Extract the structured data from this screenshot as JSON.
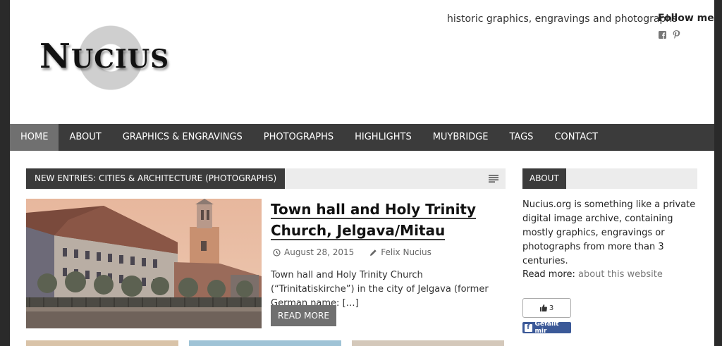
{
  "header": {
    "logo": "Nucius",
    "tagline": "historic graphics, engravings and photographs",
    "follow_label": "Follow me",
    "social_icons": [
      "facebook-icon",
      "pinterest-icon"
    ]
  },
  "nav": {
    "items": [
      {
        "label": "HOME",
        "active": true
      },
      {
        "label": "ABOUT"
      },
      {
        "label": "GRAPHICS & ENGRAVINGS"
      },
      {
        "label": "PHOTOGRAPHS"
      },
      {
        "label": "HIGHLIGHTS"
      },
      {
        "label": "MUYBRIDGE"
      },
      {
        "label": "TAGS"
      },
      {
        "label": "CONTACT"
      }
    ]
  },
  "section": {
    "label": "NEW ENTRIES: CITIES & ARCHITECTURE (PHOTOGRAPHS)"
  },
  "post": {
    "title": "Town hall and Holy Trinity Church, Jelgava/Mitau",
    "date": "August 28, 2015",
    "author": "Felix Nucius",
    "excerpt": "Town hall and Holy Trinity Church (“Trinitatiskirche”) in the city of Jelgava (former German name: […]",
    "read_more": "READ MORE"
  },
  "sidebar": {
    "title": "ABOUT",
    "text": "Nucius.org is something like a private digital image archive, containing mostly graphics, engravings or photographs from more than 3 centuries.",
    "read_more_label": "Read more: ",
    "read_more_link": "about this website",
    "like_count": "3",
    "like_button": "Gefällt mir"
  },
  "colors": {
    "nav_bg": "#3b3b3b",
    "nav_active": "#707070",
    "facebook": "#3b5998"
  }
}
